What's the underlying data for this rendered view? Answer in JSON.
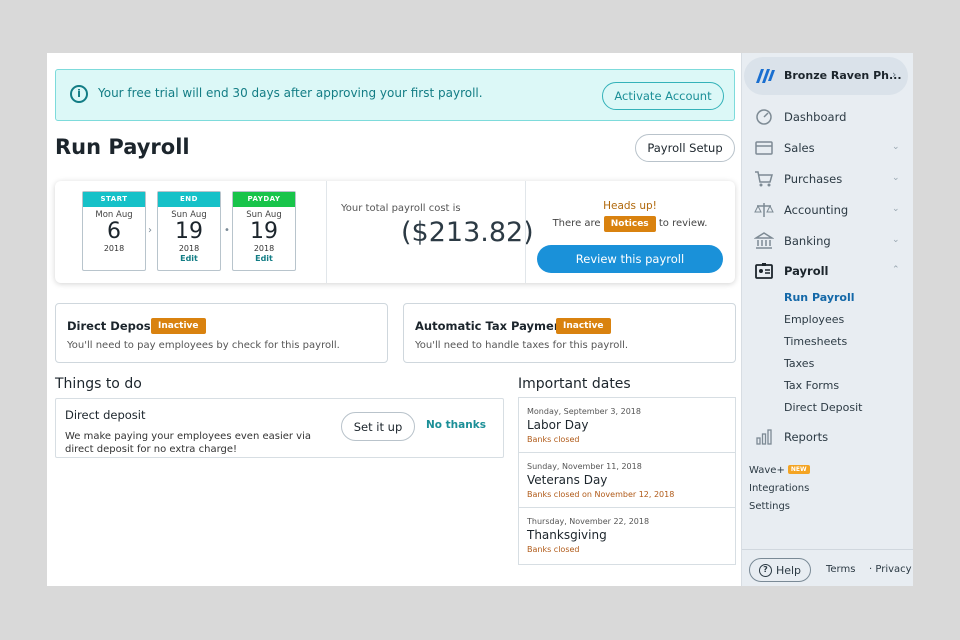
{
  "banner": {
    "message": "Your free trial will end 30 days after approving your first payroll.",
    "button": "Activate Account"
  },
  "header": {
    "title": "Run Payroll",
    "setup_button": "Payroll Setup"
  },
  "summary": {
    "calendars": [
      {
        "label": "START",
        "dow": "Mon Aug",
        "day": "6",
        "year": "2018",
        "edit": "",
        "color": "#16c1c8"
      },
      {
        "label": "END",
        "dow": "Sun Aug",
        "day": "19",
        "year": "2018",
        "edit": "Edit",
        "color": "#16c1c8"
      },
      {
        "label": "PAYDAY",
        "dow": "Sun Aug",
        "day": "19",
        "year": "2018",
        "edit": "Edit",
        "color": "#18c44a"
      }
    ],
    "cost_label": "Your total payroll cost is",
    "cost_value": "($213.82)",
    "heads_up": "Heads up!",
    "notice_pre": "There are",
    "notice_badge": "Notices",
    "notice_post": "to review.",
    "review_button": "Review this payroll"
  },
  "status_cards": [
    {
      "title": "Direct Deposit",
      "badge": "Inactive",
      "desc": "You'll need to pay employees by check for this payroll."
    },
    {
      "title": "Automatic Tax Payments",
      "badge": "Inactive",
      "desc": "You'll need to handle taxes for this payroll."
    }
  ],
  "todo": {
    "section_title": "Things to do",
    "title": "Direct deposit",
    "desc": "We make paying your employees even easier via direct deposit for no extra charge!",
    "setup_button": "Set it up",
    "dismiss_link": "No thanks"
  },
  "dates": {
    "section_title": "Important dates",
    "items": [
      {
        "date": "Monday, September 3, 2018",
        "name": "Labor Day",
        "note": "Banks closed"
      },
      {
        "date": "Sunday, November 11, 2018",
        "name": "Veterans Day",
        "note": "Banks closed on November 12, 2018"
      },
      {
        "date": "Thursday, November 22, 2018",
        "name": "Thanksgiving",
        "note": "Banks closed"
      }
    ]
  },
  "sidebar": {
    "business_name": "Bronze Raven Ph...",
    "nav": [
      {
        "label": "Dashboard",
        "icon": "dashboard-icon",
        "chevron": ""
      },
      {
        "label": "Sales",
        "icon": "sales-icon",
        "chevron": "v"
      },
      {
        "label": "Purchases",
        "icon": "cart-icon",
        "chevron": "v"
      },
      {
        "label": "Accounting",
        "icon": "scale-icon",
        "chevron": "v"
      },
      {
        "label": "Banking",
        "icon": "bank-icon",
        "chevron": "v"
      },
      {
        "label": "Payroll",
        "icon": "id-card-icon",
        "chevron": "^"
      }
    ],
    "payroll_sub": [
      "Run Payroll",
      "Employees",
      "Timesheets",
      "Taxes",
      "Tax Forms",
      "Direct Deposit"
    ],
    "reports": "Reports",
    "wave_plus": "Wave+",
    "new_tag": "NEW",
    "integrations": "Integrations",
    "settings": "Settings",
    "help": "Help",
    "terms": "Terms",
    "privacy": "Privacy"
  }
}
